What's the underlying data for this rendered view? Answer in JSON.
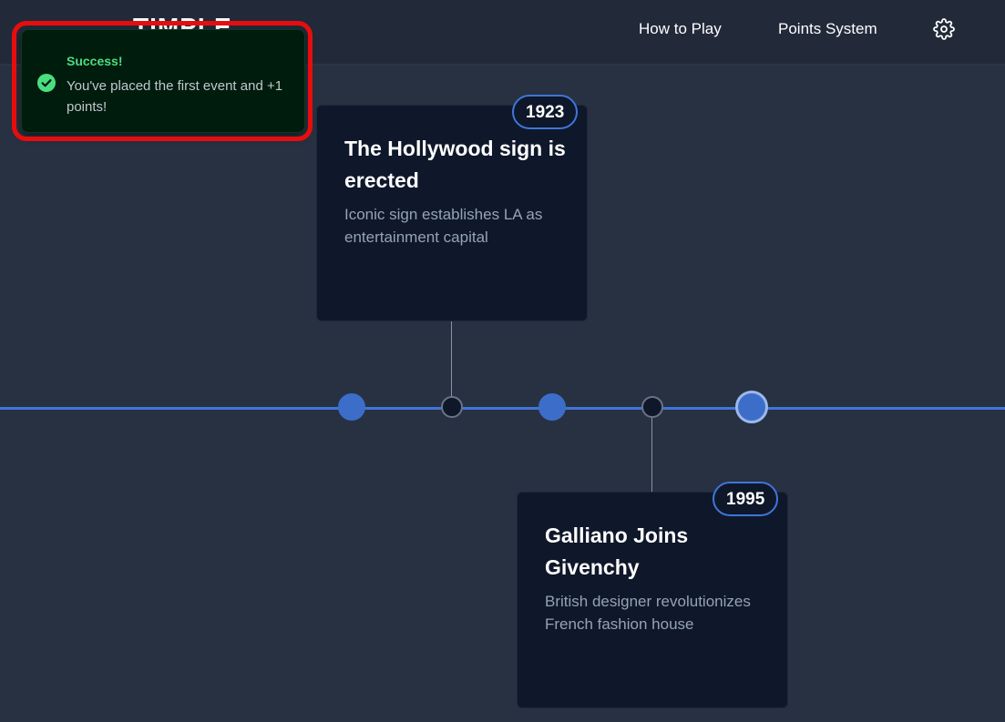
{
  "header": {
    "logo": "TIMPLE",
    "nav": {
      "how_to_play": "How to Play",
      "points_system": "Points System"
    },
    "settings_icon": "gear-icon"
  },
  "toast": {
    "title": "Success!",
    "message": "You've placed the first event and +1 points!",
    "icon": "check-circle-icon",
    "highlight_color": "#e80d0d"
  },
  "colors": {
    "timeline": "#3f76d9",
    "success": "#4ade80",
    "card_bg": "#0f172a",
    "page_bg": "#283142"
  },
  "cards": [
    {
      "year": "1923",
      "title": "The Hollywood sign is erected",
      "description": "Iconic sign establishes LA as entertainment capital"
    },
    {
      "year": "1995",
      "title": "Galliano Joins Givenchy",
      "description": "British designer revolutionizes French fashion house"
    }
  ]
}
